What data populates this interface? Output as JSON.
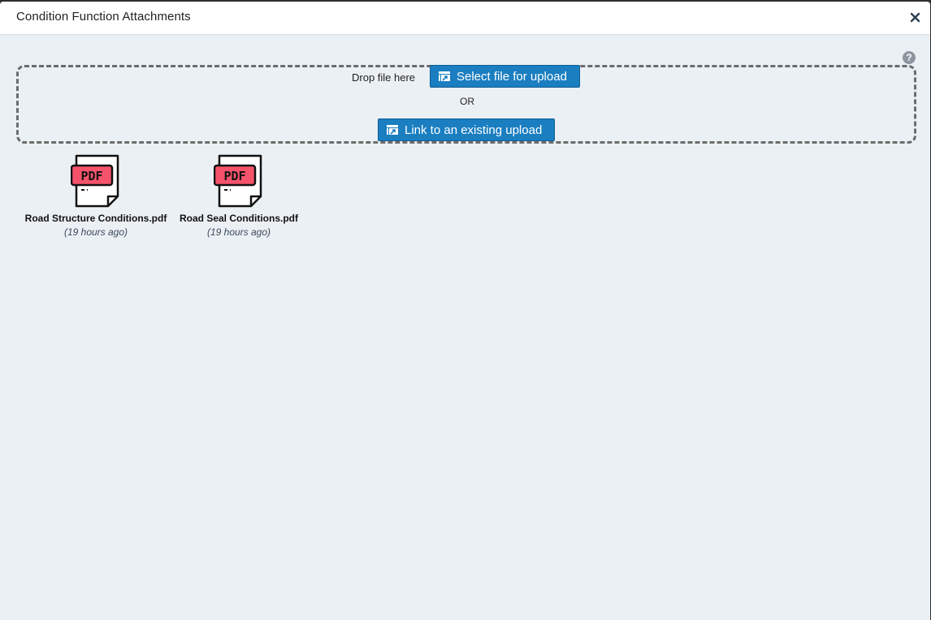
{
  "dialog": {
    "title": "Condition Function Attachments",
    "close_icon": "close-icon",
    "help_icon": "question-icon",
    "help_label": "?"
  },
  "dropzone": {
    "drop_text": "Drop file here",
    "select_button": "Select file for upload",
    "or_text": "OR",
    "link_button": "Link to an existing upload"
  },
  "attachments": [
    {
      "name": "Road Structure Conditions.pdf",
      "time": "(19 hours ago)",
      "icon": "pdf-file-icon"
    },
    {
      "name": "Road Seal Conditions.pdf",
      "time": "(19 hours ago)",
      "icon": "pdf-file-icon"
    }
  ],
  "colors": {
    "accent": "#1a7ec1",
    "background": "#ebf0f4",
    "pdf_badge": "#f5536b"
  }
}
